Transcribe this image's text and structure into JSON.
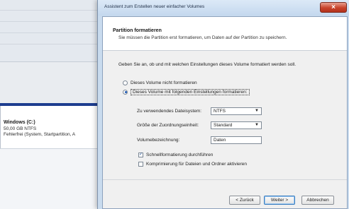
{
  "background": {
    "volume": {
      "name": "Windows (C:)",
      "size": "50,00 GB NTFS",
      "status": "Fehlerfrei (System, Startpartition, A"
    }
  },
  "wizard": {
    "title": "Assistent zum Erstellen neuer einfacher Volumes",
    "close_label": "×",
    "header": {
      "title": "Partition formatieren",
      "subtitle": "Sie müssen die Partition erst formatieren, um Daten auf der Partition zu speichern."
    },
    "instruction": "Geben Sie an, ob und mit welchen Einstellungen dieses Volume formatiert werden soll.",
    "options": {
      "no_format": {
        "label": "Dieses Volume nicht formatieren",
        "checked": false
      },
      "format": {
        "label": "Dieses Volume mit folgenden Einstellungen formatieren:",
        "checked": true
      }
    },
    "fields": {
      "filesystem": {
        "label": "Zu verwendendes Dateisystem:",
        "value": "NTFS"
      },
      "allocation": {
        "label": "Größe der Zuordnungseinheit:",
        "value": "Standard"
      },
      "volume_label": {
        "label": "Volumebezeichnung:",
        "value": "Daten"
      }
    },
    "checks": {
      "quick_format": {
        "label": "Schnellformatierung durchführen",
        "checked": true
      },
      "compression": {
        "label": "Komprimierung für Dateien und Ordner aktivieren",
        "checked": false
      }
    },
    "buttons": {
      "back": "< Zurück",
      "next": "Weiter >",
      "cancel": "Abbrechen"
    }
  },
  "colors": {
    "volume_bar": "#1d3d8f",
    "close_button": "#c8432b",
    "dialog_frame": "#c9dbee"
  }
}
